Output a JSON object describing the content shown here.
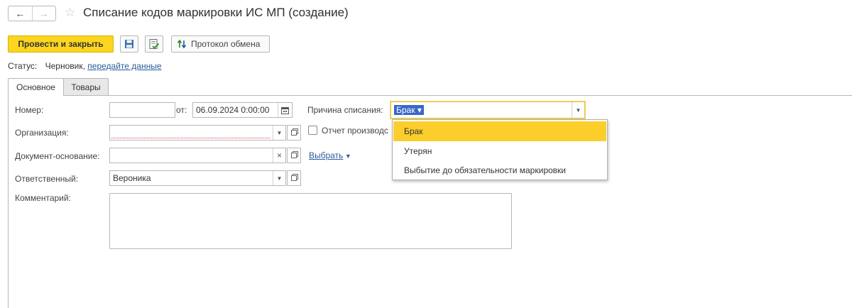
{
  "window": {
    "title": "Списание кодов маркировки ИС МП (создание)",
    "nav_back": "←",
    "nav_forward": "→",
    "favorite_icon": "☆"
  },
  "toolbar": {
    "post_and_close": "Провести и закрыть",
    "exchange_log": "Протокол обмена"
  },
  "status": {
    "label": "Статус:",
    "value": "Черновик,",
    "link": "передайте данные"
  },
  "tabs": [
    {
      "label": "Основное",
      "active": true
    },
    {
      "label": "Товары",
      "active": false
    }
  ],
  "form": {
    "number_label": "Номер:",
    "number_value": "",
    "date_label": "от:",
    "date_value": "06.09.2024  0:00:00",
    "organization_label": "Организация:",
    "organization_value": "",
    "base_doc_label": "Документ-основание:",
    "base_doc_value": "",
    "select_link": "Выбрать",
    "responsible_label": "Ответственный:",
    "responsible_value": "Вероника",
    "comment_label": "Комментарий:",
    "comment_value": "",
    "reason_label": "Причина списания:",
    "reason_value": "Брак",
    "report_checkbox_label": "Отчет производс",
    "report_checked": false
  },
  "reason_options": [
    {
      "label": "Брак",
      "selected": true
    },
    {
      "label": "Утерян",
      "selected": false
    },
    {
      "label": "Выбытие до обязательности маркировки",
      "selected": false
    }
  ],
  "colors": {
    "primary_button": "#fbd51f",
    "selected_option": "#fbce2c",
    "link": "#2a5c9c",
    "selection_chip": "#3967c8"
  }
}
